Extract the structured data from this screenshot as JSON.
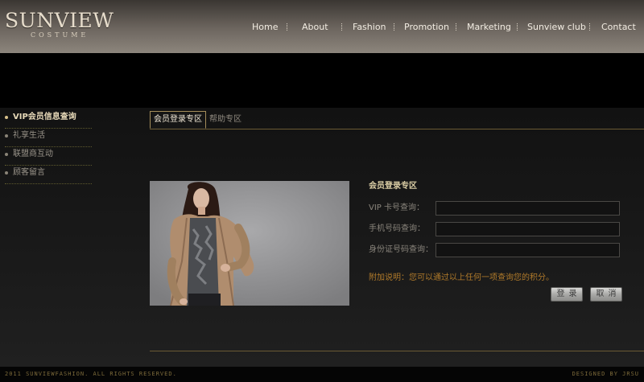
{
  "brand": {
    "name": "SUNVIEW",
    "sub": "COSTUME"
  },
  "nav": {
    "items": [
      "Home",
      "About",
      "Fashion",
      "Promotion",
      "Marketing",
      "Sunview club",
      "Contact"
    ]
  },
  "sidebar": {
    "items": [
      {
        "label": "VIP会员信息查询",
        "active": true
      },
      {
        "label": "礼享生活",
        "active": false
      },
      {
        "label": "联盟商互动",
        "active": false
      },
      {
        "label": "顾客留言",
        "active": false
      }
    ]
  },
  "tabs": {
    "items": [
      {
        "label": "会员登录专区",
        "active": true
      },
      {
        "label": "帮助专区",
        "active": false
      }
    ]
  },
  "form": {
    "title": "会员登录专区",
    "vip_label": "VIP 卡号查询：",
    "vip_value": "",
    "phone_label": "手机号码查询：",
    "phone_value": "",
    "id_label": "身份证号码查询：",
    "id_value": "",
    "note": "附加说明：您可以通过以上任何一项查询您的积分。",
    "login_label": "登录",
    "cancel_label": "取消"
  },
  "footer": {
    "copyright": "2011 SUNVIEWFASHION. ALL RIGHTS RESERVED.",
    "designer": "DESIGNED BY JRSU"
  },
  "colors": {
    "accent_gold": "#dccfa6",
    "note_orange": "#b07a2a",
    "line_gold": "#6b5a34"
  }
}
